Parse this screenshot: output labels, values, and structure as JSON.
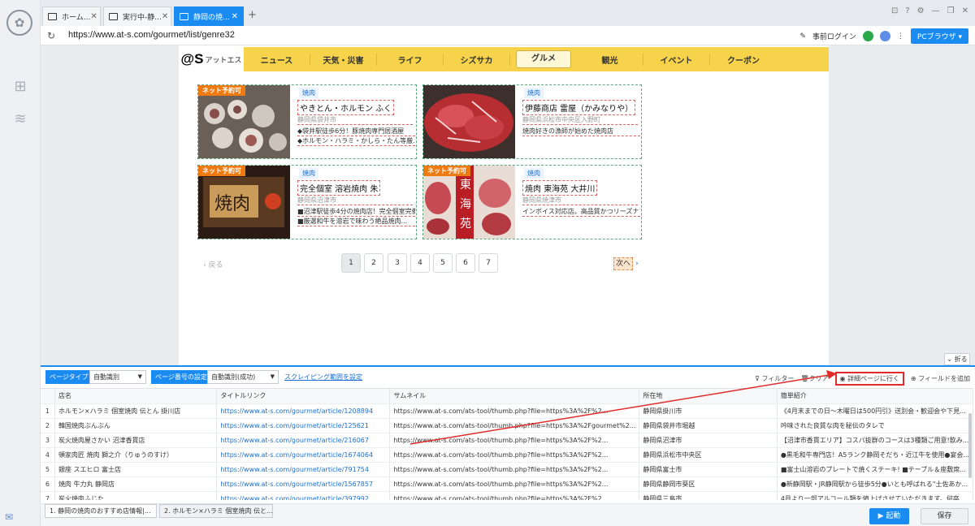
{
  "browser": {
    "tabs": [
      {
        "label": "ホーム..."
      },
      {
        "label": "実行中-静..."
      },
      {
        "label": "静岡の焼..."
      }
    ],
    "url": "https://www.at-s.com/gourmet/list/genre32",
    "login_label": "事前ログイン",
    "pc_browser_label": "PCブラウザ"
  },
  "site": {
    "brand": "@S",
    "brand_sub": "アットエス",
    "nav": [
      "ニュース",
      "天気・災害",
      "ライフ",
      "シズサカ",
      "グルメ",
      "観光",
      "イベント",
      "クーポン"
    ],
    "active_nav": "グルメ"
  },
  "cards": [
    {
      "badge": "ネット予約可",
      "category": "焼肉",
      "name": "やきとん・ホルモン ふく",
      "location": "静岡県袋井市",
      "line1": "◆袋井駅徒歩6分！豚焼肉専門居酒屋",
      "line2": "◆ホルモン・ハラミ・かしら・たん等厳..."
    },
    {
      "badge": "",
      "category": "焼肉",
      "name": "伊藤商店 雷屋（かみなりや）",
      "location": "静岡県浜松市中央区入野町",
      "line1": "焼肉好きの漁師が始めた焼肉店",
      "line2": ""
    },
    {
      "badge": "ネット予約可",
      "category": "焼肉",
      "name": "完全個室 溶岩焼肉 朱",
      "location": "静岡県沼津市",
      "line1": "■沼津駅徒歩4分の焼肉店！完全個室完備",
      "line2": "■厳選和牛を溶岩で味わう絶品焼肉..."
    },
    {
      "badge": "ネット予約可",
      "category": "焼肉",
      "name": "焼肉 東海苑 大井川",
      "location": "静岡県焼津市",
      "line1": "インボイス対応店。高品質かつリーズナブ",
      "line2": ""
    }
  ],
  "pagination": {
    "prev": "戻る",
    "pages": [
      "1",
      "2",
      "3",
      "4",
      "5",
      "6",
      "7"
    ],
    "current": "1",
    "next": "次へ"
  },
  "collapse_label": "折る",
  "panel": {
    "page_type_label": "ページタイプ",
    "page_type_value": "自動識別",
    "page_num_label": "ページ番号の設定",
    "page_num_value": "自動識別(成功)",
    "scrape_range_link": "スクレイピング範囲を設定",
    "filter": "フィルター",
    "clear": "クリア",
    "detail": "詳細ページに行く",
    "add_field": "フィールドを追加",
    "columns": [
      "",
      "店名",
      "タイトルリンク",
      "サムネイル",
      "所在地",
      "簡単紹介"
    ],
    "rows": [
      [
        "1",
        "ホルモン×ハラミ 個室焼肉 伝とん 掛川店",
        "https://www.at-s.com/gourmet/article/1208894",
        "https://www.at-s.com/ats-tool/thumb.php?file=https%3A%2F%2...",
        "静岡県掛川市",
        "《4月末までの日～木曜日は500円引》送別会・歓迎会や下見..."
      ],
      [
        "2",
        "韓国焼肉ぶんぶん",
        "https://www.at-s.com/gourmet/article/125621",
        "https://www.at-s.com/ats-tool/thumb.php?file=https%3A%2Fgourmet%2...",
        "静岡県袋井市堀越",
        "吟味された良質な肉を秘伝のタレで"
      ],
      [
        "3",
        "炭火焼肉屋さかい 沼津香貫店",
        "https://www.at-s.com/gourmet/article/216067",
        "https://www.at-s.com/ats-tool/thumb.php?file=https%3A%2F%2...",
        "静岡県沼津市",
        "【沼津市香貫エリア】コスパ抜群のコースは3種類ご用意!飲み..."
      ],
      [
        "4",
        "頓家肉匠 焼肉 獅之介（りゅうのすけ）",
        "https://www.at-s.com/gourmet/article/1674064",
        "https://www.at-s.com/ats-tool/thumb.php?file=https%3A%2F%2...",
        "静岡県浜松市中央区",
        "●黒毛和牛専門店！A5ランク静岡そだち・近江牛を使用●宴会..."
      ],
      [
        "5",
        "銀座 スエヒロ 富士店",
        "https://www.at-s.com/gourmet/article/791754",
        "https://www.at-s.com/ats-tool/thumb.php?file=https%3A%2F%2...",
        "静岡県富士市",
        "■富士山溶岩のプレートで焼くステーキ! ■テーブル＆座敷席..."
      ],
      [
        "6",
        "焼肉 牛力丸 静岡店",
        "https://www.at-s.com/gourmet/article/1567857",
        "https://www.at-s.com/ats-tool/thumb.php?file=https%3A%2F%2...",
        "静岡県静岡市葵区",
        "●新静岡駅・JR静岡駅から徒歩5分●いとも呼ばれる\"土佐あか..."
      ],
      [
        "7",
        "炭火焼肉ふじた",
        "https://www.at-s.com/gourmet/article/397992",
        "https://www.at-s.com/ats-tool/thumb.php?file=https%3A%2F%2...",
        "静岡県三島市",
        "4月より一部アルコール類を値上げさせていただきます。何卒..."
      ]
    ]
  },
  "bottom": {
    "tabs": [
      "1. 静岡の焼肉のおすすめ店情報|...",
      "2. ホルモン×ハラミ 個室焼肉 伝と..."
    ],
    "run": "起動",
    "save": "保存"
  },
  "colors": {
    "accent": "#1a8bf0",
    "nav_yellow": "#f6d34a",
    "annotation_red": "#e02b2b",
    "badge_orange": "#f07a12"
  }
}
